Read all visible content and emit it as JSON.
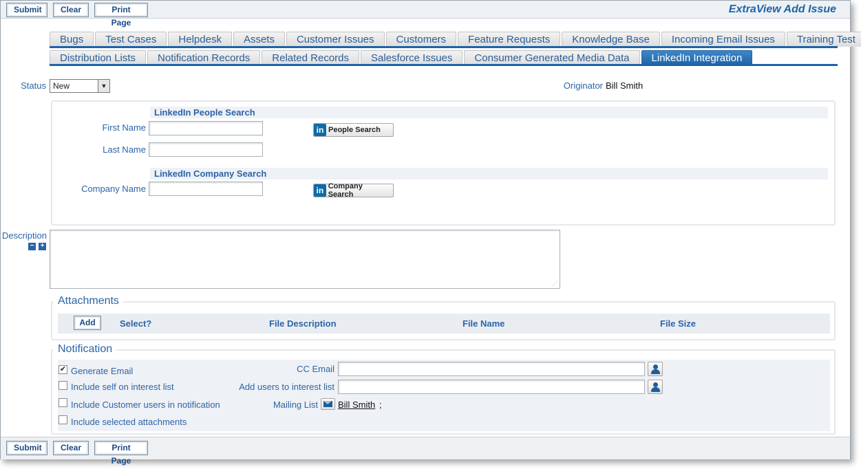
{
  "toolbar": {
    "submit": "Submit",
    "clear": "Clear",
    "print": "Print Page",
    "app_title": "ExtraView Add Issue"
  },
  "tabs_row1": [
    "Bugs",
    "Test Cases",
    "Helpdesk",
    "Assets",
    "Customer Issues",
    "Customers",
    "Feature Requests",
    "Knowledge Base",
    "Incoming Email Issues",
    "Training Test"
  ],
  "tabs_row2": [
    "Distribution Lists",
    "Notification Records",
    "Related Records",
    "Salesforce Issues",
    "Consumer Generated Media Data",
    "LinkedIn Integration"
  ],
  "active_tab": "LinkedIn Integration",
  "status": {
    "label": "Status",
    "value": "New"
  },
  "originator": {
    "label": "Originator",
    "value": "Bill Smith"
  },
  "people_search": {
    "heading": "LinkedIn People Search",
    "first_name_label": "First Name",
    "first_name_value": "",
    "last_name_label": "Last Name",
    "last_name_value": "",
    "button": "People Search"
  },
  "company_search": {
    "heading": "LinkedIn Company Search",
    "company_label": "Company Name",
    "company_value": "",
    "button": "Company Search"
  },
  "description": {
    "label": "Description",
    "value": ""
  },
  "attachments": {
    "title": "Attachments",
    "add": "Add",
    "columns": [
      "Select?",
      "File Description",
      "File Name",
      "File Size"
    ]
  },
  "notification": {
    "title": "Notification",
    "generate_email": {
      "label": "Generate Email",
      "checked": true
    },
    "include_self": {
      "label": "Include self on interest list",
      "checked": false
    },
    "include_customers": {
      "label": "Include Customer users in notification",
      "checked": false
    },
    "include_attachments": {
      "label": "Include selected attachments",
      "checked": false
    },
    "cc_email_label": "CC Email",
    "add_users_label": "Add users to interest list",
    "mailing_list_label": "Mailing List",
    "mailing_list_user": "Bill Smith",
    "mailing_list_sep": ";"
  },
  "colors": {
    "accent": "#1e63a6",
    "label": "#2c64a8",
    "panel_bg": "#eef1f5"
  }
}
